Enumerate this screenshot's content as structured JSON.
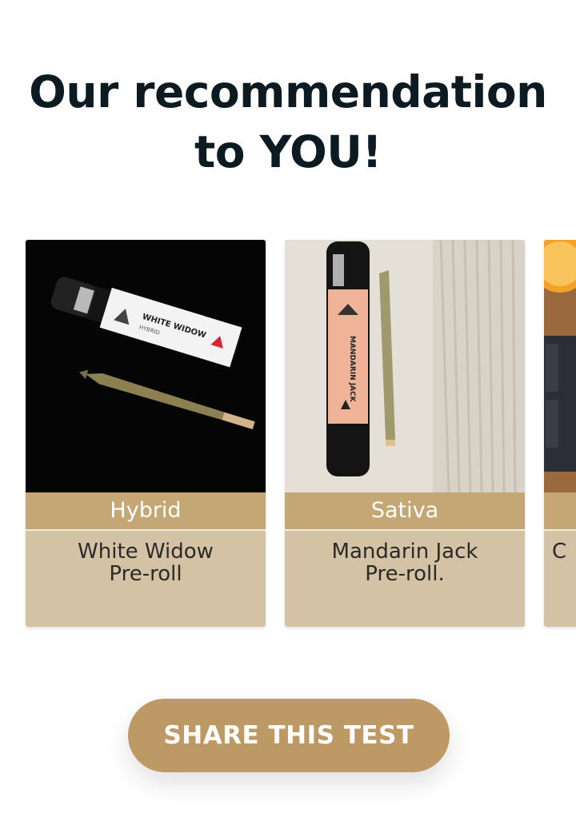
{
  "heading": {
    "line1": "Our recommendation",
    "line2": "to YOU!"
  },
  "products": [
    {
      "tag": "Hybrid",
      "name": "White Widow\nPre-roll",
      "image_icon": "white-widow-preroll-photo"
    },
    {
      "tag": "Sativa",
      "name": "Mandarin Jack\nPre-roll.",
      "image_icon": "mandarin-jack-preroll-photo"
    },
    {
      "tag": "",
      "name": "C",
      "image_icon": "chocolate-orange-photo"
    }
  ],
  "share_button": {
    "label": "SHARE THIS TEST"
  },
  "colors": {
    "heading": "#0c1a22",
    "tag_bg": "#c4a775",
    "card_bg": "#d4c2a5",
    "button_bg": "#bd9965"
  }
}
